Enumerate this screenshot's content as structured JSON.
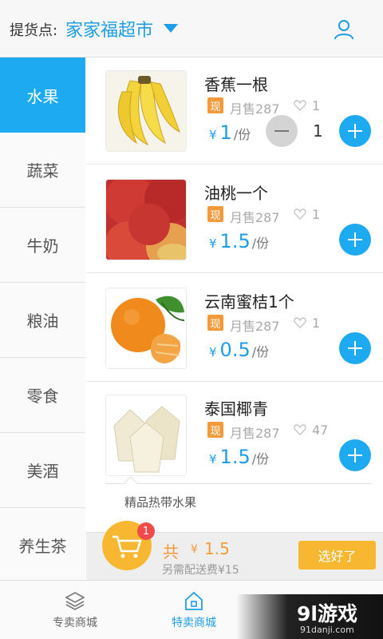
{
  "header": {
    "pickup_label": "提货点:",
    "store_name": "家家福超市",
    "dropdown_icon": "caret-down-icon",
    "user_icon": "user-icon"
  },
  "categories": [
    {
      "label": "水果",
      "active": true
    },
    {
      "label": "蔬菜",
      "active": false
    },
    {
      "label": "牛奶",
      "active": false
    },
    {
      "label": "粮油",
      "active": false
    },
    {
      "label": "零食",
      "active": false
    },
    {
      "label": "美酒",
      "active": false
    },
    {
      "label": "养生茶",
      "active": false
    }
  ],
  "products": [
    {
      "name": "香蕉一根",
      "badge": "现",
      "sales": "月售287",
      "likes": "1",
      "currency": "¥",
      "price": "1",
      "unit": "/份",
      "quantity": "1"
    },
    {
      "name": "油桃一个",
      "badge": "现",
      "sales": "月售287",
      "likes": "1",
      "currency": "¥",
      "price": "1.5",
      "unit": "/份"
    },
    {
      "name": "云南蜜桔1个",
      "badge": "现",
      "sales": "月售287",
      "likes": "1",
      "currency": "¥",
      "price": "0.5",
      "unit": "/份"
    },
    {
      "name": "泰国椰青",
      "badge": "现",
      "sales": "月售287",
      "likes": "47",
      "currency": "¥",
      "price": "1.5",
      "unit": "/份"
    }
  ],
  "tooltip": {
    "text": "精品热带水果"
  },
  "cart": {
    "count": "1",
    "total_label": "共",
    "currency": "¥",
    "total": "1.5",
    "delivery_note": "另需配送费¥15",
    "done_label": "选好了"
  },
  "bottom_nav": [
    {
      "label": "专卖商城",
      "icon": "layers-icon",
      "active": false
    },
    {
      "label": "特卖商城",
      "icon": "home-icon",
      "active": true
    }
  ],
  "watermark": {
    "logo": "9l游戏",
    "url": "91danji.com"
  },
  "colors": {
    "accent": "#1eaaf1",
    "price": "#1e9ee6",
    "badge": "#f39a3a",
    "cart": "#f7b731",
    "count_badge": "#ef4b4b"
  }
}
